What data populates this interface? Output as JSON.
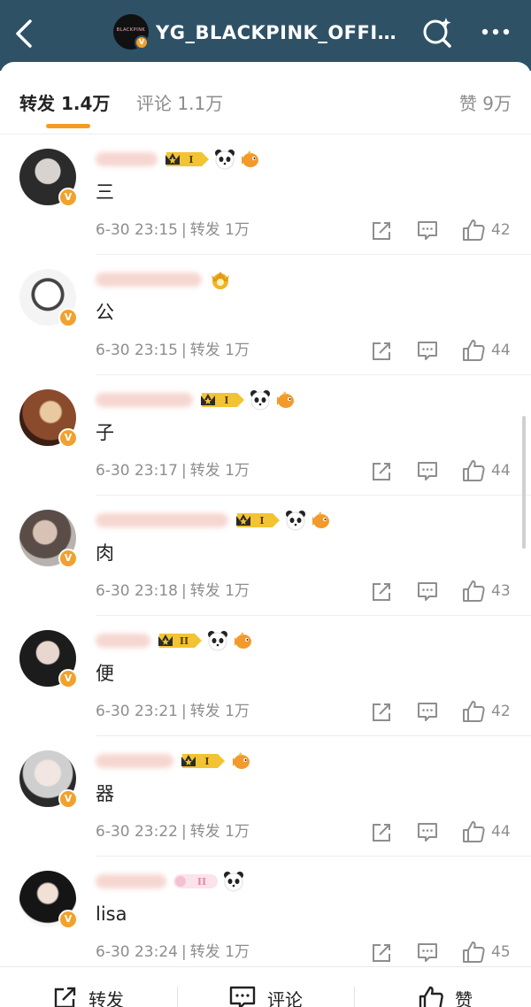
{
  "header": {
    "title": "YG_BLACKPINK_OFFI…",
    "avatar_logo_text": "BLACKPINK",
    "verified_mark": "V",
    "icons": [
      "back-icon",
      "search-icon",
      "more-icon"
    ],
    "background_color": "#2e5166"
  },
  "tabs": {
    "repost_label": "转发 1.4万",
    "comments_label": "评论 1.1万",
    "likes_label": "赞 9万",
    "active": "repost",
    "accent_color": "#f59b23"
  },
  "reposts": [
    {
      "text": "三",
      "time": "6-30 23:15",
      "repost_label": "转发 1万",
      "likes": "42"
    },
    {
      "text": "公",
      "time": "6-30 23:15",
      "repost_label": "转发 1万",
      "likes": "44"
    },
    {
      "text": "子",
      "time": "6-30 23:17",
      "repost_label": "转发 1万",
      "likes": "44"
    },
    {
      "text": "肉",
      "time": "6-30 23:18",
      "repost_label": "转发 1万",
      "likes": "43"
    },
    {
      "text": "便",
      "time": "6-30 23:21",
      "repost_label": "转发 1万",
      "likes": "42"
    },
    {
      "text": "器",
      "time": "6-30 23:22",
      "repost_label": "转发 1万",
      "likes": "44"
    },
    {
      "text": "lisa",
      "time": "6-30 23:24",
      "repost_label": "转发 1万",
      "likes": "45"
    }
  ],
  "bottom_bar": {
    "repost_label": "转发",
    "comment_label": "评论",
    "like_label": "赞"
  },
  "colors": {
    "verified_badge": "#f1a12d",
    "meta_text": "#8e8e8e"
  }
}
